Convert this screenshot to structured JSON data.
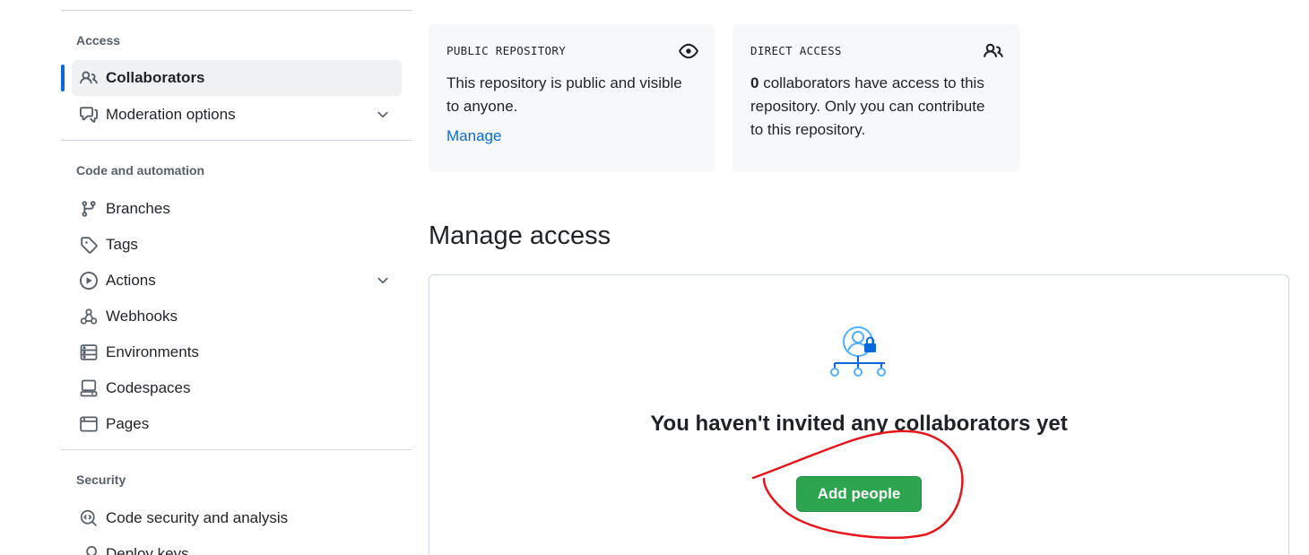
{
  "sidebar": {
    "sections": [
      {
        "heading": "Access",
        "items": [
          {
            "label": "Collaborators",
            "icon": "people-icon",
            "active": true
          },
          {
            "label": "Moderation options",
            "icon": "comment-discussion-icon",
            "expandable": true
          }
        ]
      },
      {
        "heading": "Code and automation",
        "items": [
          {
            "label": "Branches",
            "icon": "git-branch-icon"
          },
          {
            "label": "Tags",
            "icon": "tag-icon"
          },
          {
            "label": "Actions",
            "icon": "play-icon",
            "expandable": true
          },
          {
            "label": "Webhooks",
            "icon": "webhook-icon"
          },
          {
            "label": "Environments",
            "icon": "server-icon"
          },
          {
            "label": "Codespaces",
            "icon": "codespaces-icon"
          },
          {
            "label": "Pages",
            "icon": "browser-icon"
          }
        ]
      },
      {
        "heading": "Security",
        "items": [
          {
            "label": "Code security and analysis",
            "icon": "codescan-icon"
          },
          {
            "label": "Deploy keys",
            "icon": "key-icon"
          }
        ]
      }
    ]
  },
  "cards": {
    "public": {
      "title": "PUBLIC REPOSITORY",
      "text": "This repository is public and visible to anyone.",
      "link": "Manage",
      "icon": "eye-icon"
    },
    "direct": {
      "title": "DIRECT ACCESS",
      "count": "0",
      "text": " collaborators have access to this repository. Only you can contribute to this repository.",
      "icon": "people-icon"
    }
  },
  "manage": {
    "title": "Manage access",
    "empty_message": "You haven't invited any collaborators yet",
    "add_button": "Add people",
    "icon": "person-lock-network-icon"
  },
  "colors": {
    "accent": "#0969da",
    "button_green": "#2da44e",
    "annotation_red": "#e8141b"
  }
}
